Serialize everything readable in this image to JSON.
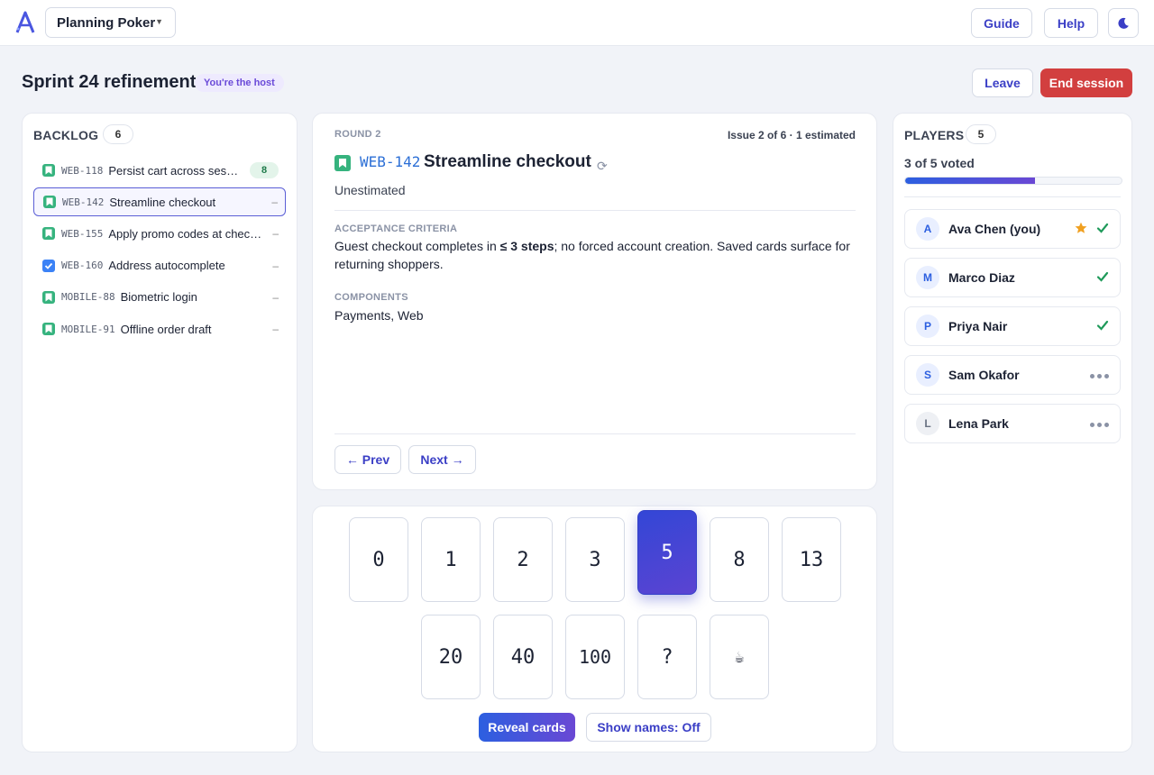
{
  "header": {
    "app_selector": "Planning Poker",
    "guide_label": "Guide",
    "help_label": "Help",
    "theme_icon": "moon-icon"
  },
  "session": {
    "title": "Sprint 24 refinement",
    "host_badge": "You're the host",
    "leave_label": "Leave",
    "end_label": "End session",
    "end_color": "#d23f3f"
  },
  "backlog": {
    "heading": "BACKLOG",
    "count": "6",
    "items": [
      {
        "key": "WEB-118",
        "title": "Persist cart across sessions",
        "points": "8",
        "type": "story"
      },
      {
        "key": "WEB-142",
        "title": "Streamline checkout",
        "points": "–",
        "type": "story"
      },
      {
        "key": "WEB-155",
        "title": "Apply promo codes at checkout",
        "points": "–",
        "type": "story"
      },
      {
        "key": "WEB-160",
        "title": "Address autocomplete",
        "points": "–",
        "type": "task"
      },
      {
        "key": "MOBILE-88",
        "title": "Biometric login",
        "points": "–",
        "type": "story"
      },
      {
        "key": "MOBILE-91",
        "title": "Offline order draft",
        "points": "–",
        "type": "story"
      }
    ]
  },
  "issue": {
    "round": "ROUND 2",
    "progress": "Issue 2 of 6 · 1 estimated",
    "key": "WEB-142",
    "title": "Streamline checkout",
    "estimate_state": "Unestimated",
    "criteria_label": "ACCEPTANCE CRITERIA",
    "criteria_pre": "Guest checkout completes in ",
    "criteria_bold": "≤ 3 steps",
    "criteria_post": "; no forced account creation. Saved cards surface for returning shoppers.",
    "components_label": "COMPONENTS",
    "components": "Payments, Web",
    "prev_label": "← Prev",
    "next_label": "Next →"
  },
  "cards": {
    "values": [
      "0",
      "1",
      "2",
      "3",
      "5",
      "8",
      "13",
      "20",
      "40",
      "100",
      "?",
      "☕"
    ],
    "selected": "5",
    "reveal_label": "Reveal cards",
    "names_label": "Show names: Off"
  },
  "players": {
    "heading": "PLAYERS",
    "count": "5",
    "voted_text": "3 of 5 voted",
    "voted_fraction": 0.6,
    "list": [
      {
        "initial": "A",
        "name": "Ava Chen (you)",
        "status": "voted",
        "host": true
      },
      {
        "initial": "M",
        "name": "Marco Diaz",
        "status": "voted",
        "host": false
      },
      {
        "initial": "P",
        "name": "Priya Nair",
        "status": "voted",
        "host": false
      },
      {
        "initial": "S",
        "name": "Sam Okafor",
        "status": "waiting",
        "host": false
      },
      {
        "initial": "L",
        "name": "Lena Park",
        "status": "waiting",
        "host": false
      }
    ]
  },
  "colors": {
    "accent": "#3b3fc6",
    "voted_check": "#1f9a5a",
    "host_star": "#f0a020"
  }
}
